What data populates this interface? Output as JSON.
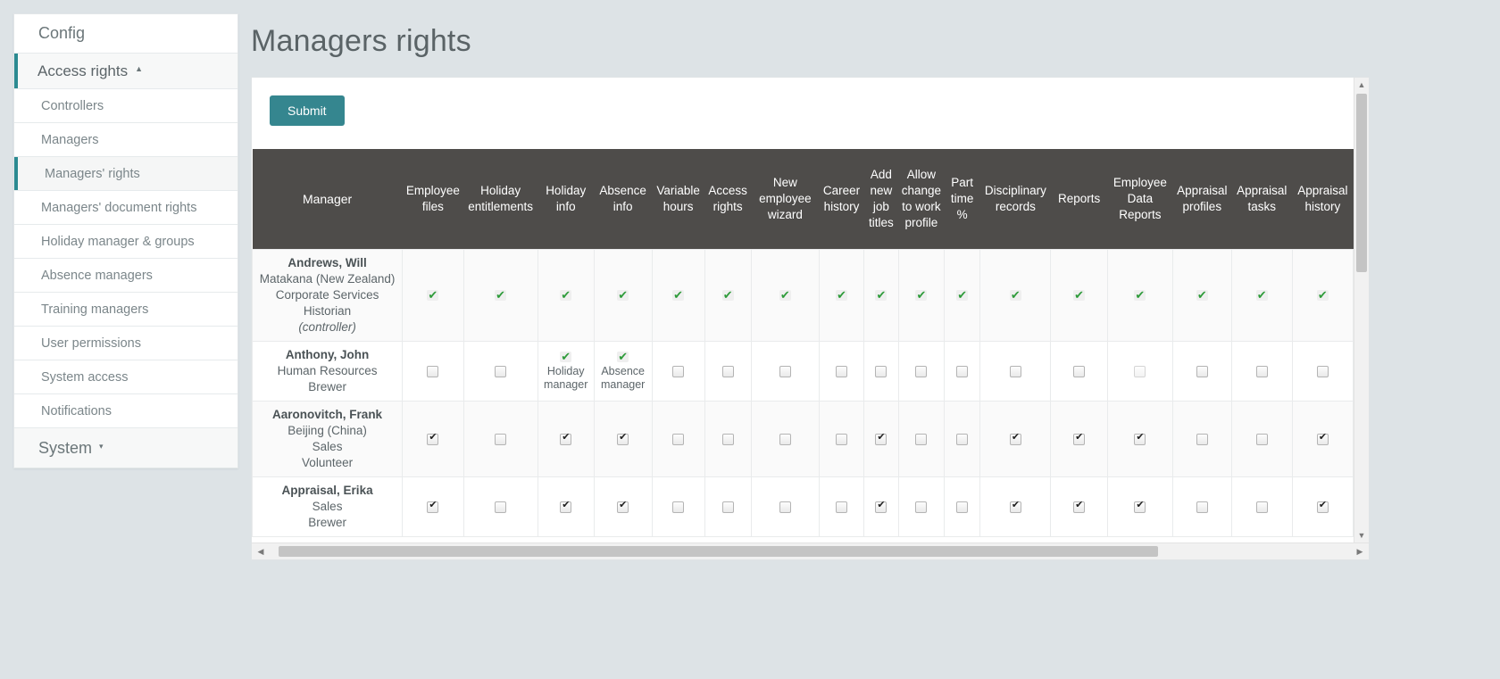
{
  "sidebar": {
    "title": "Config",
    "group": {
      "label": "Access rights",
      "caret": "▲"
    },
    "items": [
      {
        "label": "Controllers"
      },
      {
        "label": "Managers"
      },
      {
        "label": "Managers' rights"
      },
      {
        "label": "Managers' document rights"
      },
      {
        "label": "Holiday manager & groups"
      },
      {
        "label": "Absence managers"
      },
      {
        "label": "Training managers"
      },
      {
        "label": "User permissions"
      },
      {
        "label": "System access"
      },
      {
        "label": "Notifications"
      }
    ],
    "selected_index": 2,
    "bottom": {
      "label": "System",
      "caret": "▾"
    }
  },
  "header": {
    "title": "Managers rights"
  },
  "toolbar": {
    "submit_label": "Submit"
  },
  "colors": {
    "accent": "#35868f",
    "header_row": "#4e4c4a",
    "tick_green": "#2e9b3a",
    "page_bg": "#dde3e6"
  },
  "table": {
    "columns": [
      "Manager",
      "Employee files",
      "Holiday entitlements",
      "Holiday info",
      "Absence info",
      "Variable hours",
      "Access rights",
      "New employee wizard",
      "Career history",
      "Add new job titles",
      "Allow change to work profile",
      "Part time %",
      "Disciplinary records",
      "Reports",
      "Employee Data Reports",
      "Appraisal profiles",
      "Appraisal tasks",
      "Appraisal history"
    ],
    "rows": [
      {
        "name": "Andrews, Will",
        "lines": [
          "Matakana (New Zealand)",
          "Corporate Services",
          "Historian"
        ],
        "note": "(controller)",
        "cells": [
          {
            "type": "tick"
          },
          {
            "type": "tick"
          },
          {
            "type": "tick"
          },
          {
            "type": "tick"
          },
          {
            "type": "tick"
          },
          {
            "type": "tick"
          },
          {
            "type": "tick"
          },
          {
            "type": "tick"
          },
          {
            "type": "tick"
          },
          {
            "type": "tick"
          },
          {
            "type": "tick"
          },
          {
            "type": "tick"
          },
          {
            "type": "tick"
          },
          {
            "type": "tick"
          },
          {
            "type": "tick"
          },
          {
            "type": "tick"
          },
          {
            "type": "tick"
          }
        ]
      },
      {
        "name": "Anthony, John",
        "lines": [
          "Human Resources",
          "Brewer"
        ],
        "note": "",
        "cells": [
          {
            "type": "checkbox",
            "checked": false
          },
          {
            "type": "checkbox",
            "checked": false
          },
          {
            "type": "tick",
            "label": "Holiday manager"
          },
          {
            "type": "tick",
            "label": "Absence manager"
          },
          {
            "type": "checkbox",
            "checked": false
          },
          {
            "type": "checkbox",
            "checked": false
          },
          {
            "type": "checkbox",
            "checked": false
          },
          {
            "type": "checkbox",
            "checked": false
          },
          {
            "type": "checkbox",
            "checked": false
          },
          {
            "type": "checkbox",
            "checked": false
          },
          {
            "type": "checkbox",
            "checked": false
          },
          {
            "type": "checkbox",
            "checked": false
          },
          {
            "type": "checkbox",
            "checked": false
          },
          {
            "type": "checkbox",
            "checked": false,
            "dim": true
          },
          {
            "type": "checkbox",
            "checked": false
          },
          {
            "type": "checkbox",
            "checked": false
          },
          {
            "type": "checkbox",
            "checked": false
          }
        ]
      },
      {
        "name": "Aaronovitch, Frank",
        "lines": [
          "Beijing (China)",
          "Sales",
          "Volunteer"
        ],
        "note": "",
        "cells": [
          {
            "type": "checkbox",
            "checked": true
          },
          {
            "type": "checkbox",
            "checked": false
          },
          {
            "type": "checkbox",
            "checked": true
          },
          {
            "type": "checkbox",
            "checked": true
          },
          {
            "type": "checkbox",
            "checked": false
          },
          {
            "type": "checkbox",
            "checked": false
          },
          {
            "type": "checkbox",
            "checked": false
          },
          {
            "type": "checkbox",
            "checked": false
          },
          {
            "type": "checkbox",
            "checked": true
          },
          {
            "type": "checkbox",
            "checked": false
          },
          {
            "type": "checkbox",
            "checked": false
          },
          {
            "type": "checkbox",
            "checked": true
          },
          {
            "type": "checkbox",
            "checked": true
          },
          {
            "type": "checkbox",
            "checked": true
          },
          {
            "type": "checkbox",
            "checked": false
          },
          {
            "type": "checkbox",
            "checked": false
          },
          {
            "type": "checkbox",
            "checked": true
          }
        ]
      },
      {
        "name": "Appraisal, Erika",
        "lines": [
          "Sales",
          "Brewer"
        ],
        "note": "",
        "cells": [
          {
            "type": "checkbox",
            "checked": true
          },
          {
            "type": "checkbox",
            "checked": false
          },
          {
            "type": "checkbox",
            "checked": true
          },
          {
            "type": "checkbox",
            "checked": true
          },
          {
            "type": "checkbox",
            "checked": false
          },
          {
            "type": "checkbox",
            "checked": false
          },
          {
            "type": "checkbox",
            "checked": false
          },
          {
            "type": "checkbox",
            "checked": false
          },
          {
            "type": "checkbox",
            "checked": true
          },
          {
            "type": "checkbox",
            "checked": false
          },
          {
            "type": "checkbox",
            "checked": false
          },
          {
            "type": "checkbox",
            "checked": true
          },
          {
            "type": "checkbox",
            "checked": true
          },
          {
            "type": "checkbox",
            "checked": true
          },
          {
            "type": "checkbox",
            "checked": false
          },
          {
            "type": "checkbox",
            "checked": false
          },
          {
            "type": "checkbox",
            "checked": true
          }
        ]
      }
    ]
  },
  "scrollbars": {
    "v_up": "▲",
    "v_down": "▼",
    "h_left": "◀",
    "h_right": "▶"
  }
}
